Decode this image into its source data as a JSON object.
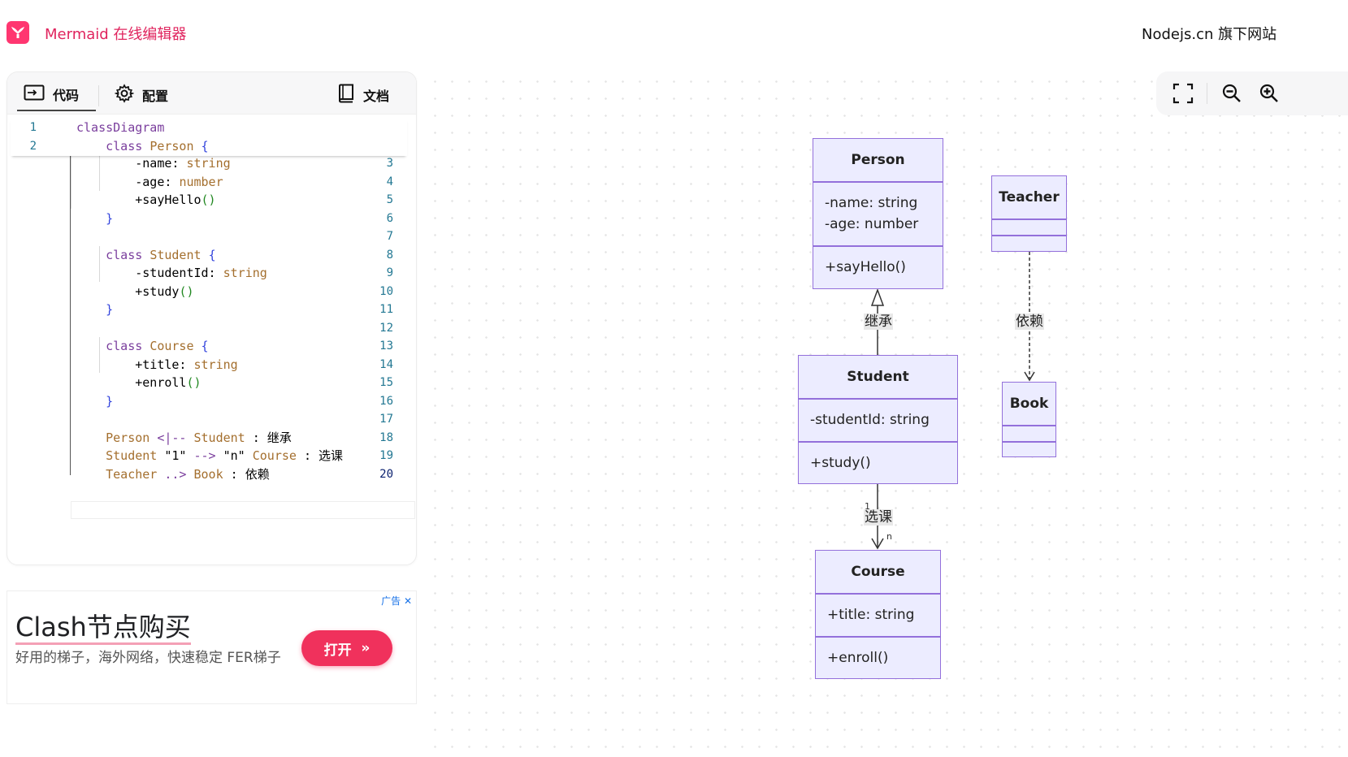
{
  "header": {
    "title": "Mermaid 在线编辑器",
    "site_link": "Nodejs.cn 旗下网站"
  },
  "tabs": {
    "code": "代码",
    "config": "配置",
    "docs": "文档"
  },
  "code_lines": [
    {
      "n": "1",
      "text": "classDiagram"
    },
    {
      "n": "2",
      "text": "    class Person {"
    },
    {
      "n": "3",
      "text": "        -name: string"
    },
    {
      "n": "4",
      "text": "        -age: number"
    },
    {
      "n": "5",
      "text": "        +sayHello()"
    },
    {
      "n": "6",
      "text": "    }"
    },
    {
      "n": "7",
      "text": ""
    },
    {
      "n": "8",
      "text": "    class Student {"
    },
    {
      "n": "9",
      "text": "        -studentId: string"
    },
    {
      "n": "10",
      "text": "        +study()"
    },
    {
      "n": "11",
      "text": "    }"
    },
    {
      "n": "12",
      "text": ""
    },
    {
      "n": "13",
      "text": "    class Course {"
    },
    {
      "n": "14",
      "text": "        +title: string"
    },
    {
      "n": "15",
      "text": "        +enroll()"
    },
    {
      "n": "16",
      "text": "    }"
    },
    {
      "n": "17",
      "text": ""
    },
    {
      "n": "18",
      "text": "    Person <|-- Student : 继承"
    },
    {
      "n": "19",
      "text": "    Student \"1\" --> \"n\" Course : 选课"
    },
    {
      "n": "20",
      "text": "    Teacher ..> Book : 依赖"
    }
  ],
  "ad": {
    "flag": "广告",
    "title": "Clash节点购买",
    "description": "好用的梯子，海外网络，快速稳定 FER梯子",
    "button": "打开"
  },
  "toolbar": {
    "icons": [
      "fullscreen-icon",
      "zoom-out-icon",
      "zoom-in-icon"
    ]
  },
  "diagram": {
    "person": {
      "name": "Person",
      "attrs": [
        "-name: string",
        "-age: number"
      ],
      "methods": [
        "+sayHello()"
      ]
    },
    "student": {
      "name": "Student",
      "attrs": [
        "-studentId: string"
      ],
      "methods": [
        "+study()"
      ]
    },
    "course": {
      "name": "Course",
      "attrs": [
        "+title: string"
      ],
      "methods": [
        "+enroll()"
      ]
    },
    "teacher": {
      "name": "Teacher"
    },
    "book": {
      "name": "Book"
    },
    "edges": {
      "inherit_label": "继承",
      "select_label": "选课",
      "depend_label": "依赖",
      "card_from": "1",
      "card_to": "n"
    }
  },
  "colors": {
    "brand": "#e0245e",
    "node_fill": "#ececff",
    "node_border": "#9370db"
  }
}
